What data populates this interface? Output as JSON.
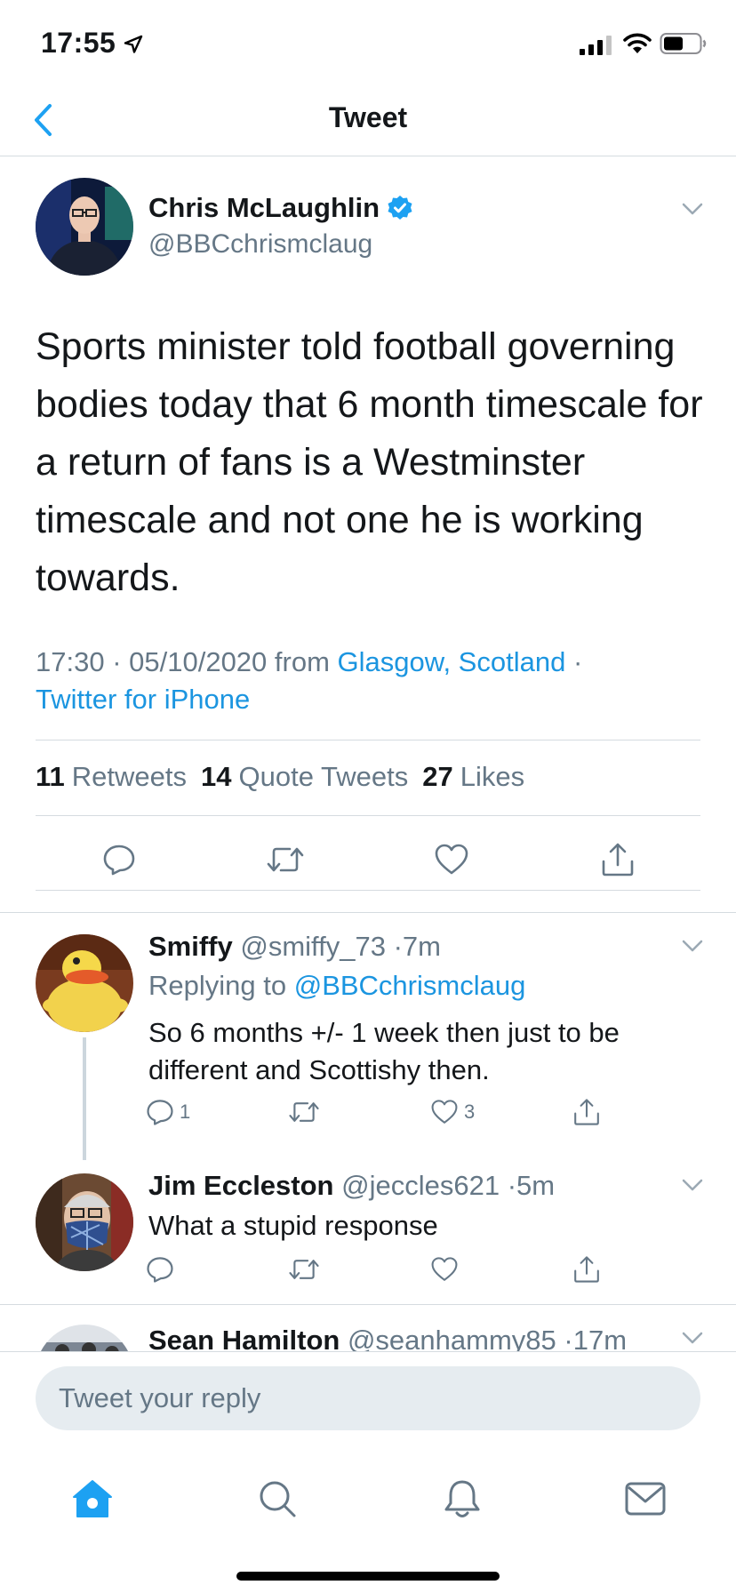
{
  "status_bar": {
    "time": "17:55"
  },
  "nav": {
    "title": "Tweet"
  },
  "main_tweet": {
    "author_name": "Chris McLaughlin",
    "author_handle": "@BBCchrismclaug",
    "text": "Sports minister told football governing bodies today that 6 month timescale for a return of fans is a Westminster timescale and not one he is working towards.",
    "time": "17:30",
    "date": "05/10/2020",
    "from_label": "from",
    "location": "Glasgow, Scotland",
    "source": "Twitter for iPhone",
    "stats": {
      "retweets_count": "11",
      "retweets_label": "Retweets",
      "quotes_count": "14",
      "quotes_label": "Quote Tweets",
      "likes_count": "27",
      "likes_label": "Likes"
    }
  },
  "replies": [
    {
      "name": "Smiffy",
      "handle": "@smiffy_73",
      "time": "7m",
      "replying_to_label": "Replying to",
      "replying_to": "@BBCchrismclaug",
      "text": "So 6 months +/- 1 week then just to be different and Scottishy then.",
      "reply_count": "1",
      "retweet_count": "",
      "like_count": "3"
    },
    {
      "name": "Jim Eccleston",
      "handle": "@jeccles621",
      "time": "5m",
      "text": "What a stupid response",
      "reply_count": "",
      "retweet_count": "",
      "like_count": ""
    },
    {
      "name": "Sean Hamilton",
      "handle": "@seanhammy85",
      "time": "17m"
    }
  ],
  "composer": {
    "placeholder": "Tweet your reply"
  },
  "tabs": [
    "home-icon",
    "search-icon",
    "notifications-icon",
    "messages-icon"
  ],
  "colors": {
    "accent": "#1da1f2",
    "link": "#1b95e0",
    "secondary_text": "#657786",
    "divider": "#d5dbe0"
  }
}
